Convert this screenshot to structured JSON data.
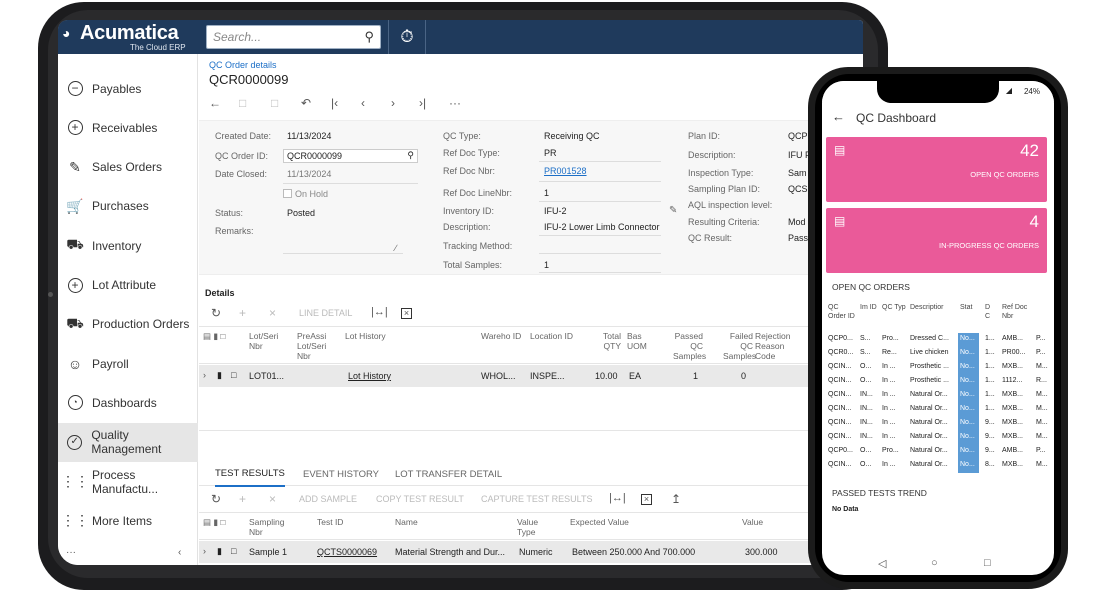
{
  "brand": {
    "name": "Acumatica",
    "tagline": "The Cloud ERP"
  },
  "search": {
    "placeholder": "Search..."
  },
  "sidebar": {
    "items": [
      {
        "label": "Payables",
        "icon": "minus-circle-icon"
      },
      {
        "label": "Receivables",
        "icon": "plus-circle-icon"
      },
      {
        "label": "Sales Orders",
        "icon": "edit-icon"
      },
      {
        "label": "Purchases",
        "icon": "cart-icon"
      },
      {
        "label": "Inventory",
        "icon": "truck-icon"
      },
      {
        "label": "Lot Attribute",
        "icon": "plus-circle-icon"
      },
      {
        "label": "Production Orders",
        "icon": "truck-icon"
      },
      {
        "label": "Payroll",
        "icon": "person-dollar-icon"
      },
      {
        "label": "Dashboards",
        "icon": "gauge-icon"
      },
      {
        "label": "Quality Management",
        "icon": "check-badge-icon"
      },
      {
        "label": "Process Manufactu...",
        "icon": "grid-icon"
      },
      {
        "label": "More Items",
        "icon": "grid-icon"
      }
    ],
    "active": "Quality Management"
  },
  "page": {
    "breadcrumb": "QC Order details",
    "title": "QCR0000099"
  },
  "form": {
    "created_date_label": "Created Date:",
    "created_date": "11/13/2024",
    "qc_order_id_label": "QC Order ID:",
    "qc_order_id": "QCR0000099",
    "date_closed_label": "Date Closed:",
    "date_closed": "11/13/2024",
    "on_hold_label": "On Hold",
    "status_label": "Status:",
    "status": "Posted",
    "remarks_label": "Remarks:",
    "qc_type_label": "QC Type:",
    "qc_type": "Receiving QC",
    "ref_doc_type_label": "Ref Doc Type:",
    "ref_doc_type": "PR",
    "ref_doc_nbr_label": "Ref Doc Nbr:",
    "ref_doc_nbr": "PR001528",
    "ref_doc_line_label": "Ref Doc LineNbr:",
    "ref_doc_line": "1",
    "inventory_id_label": "Inventory ID:",
    "inventory_id": "IFU-2",
    "description_label": "Description:",
    "description": "IFU-2 Lower Limb Connector",
    "tracking_label": "Tracking Method:",
    "total_samples_label": "Total Samples:",
    "total_samples": "1",
    "plan_id_label": "Plan ID:",
    "plan_id": "QCP",
    "desc2_label": "Description:",
    "desc2": "IFU F",
    "inspection_type_label": "Inspection Type:",
    "inspection_type": "Sam",
    "sampling_plan_label": "Sampling Plan ID:",
    "sampling_plan": "QCS",
    "aql_label": "AQL inspection level:",
    "resulting_label": "Resulting Criteria:",
    "resulting": "Mod",
    "qc_result_label": "QC Result:",
    "qc_result": "Pass"
  },
  "details": {
    "title": "Details",
    "toolbar": {
      "line_detail": "LINE DETAIL"
    },
    "columns": [
      "Lot/Seri Nbr",
      "PreAssi Lot/Seri Nbr",
      "Lot History",
      "Wareho ID",
      "Location ID",
      "Total QTY",
      "Bas UOM",
      "Passed QC Samples",
      "Failed QC Samples",
      "Rejection Reason Code"
    ],
    "row": {
      "lot": "LOT01...",
      "lot_history": "Lot History",
      "warehouse": "WHOL...",
      "location": "INSPE...",
      "total_qty": "10.00",
      "uom": "EA",
      "passed": "1",
      "failed": "0"
    }
  },
  "tabs": [
    "TEST RESULTS",
    "EVENT HISTORY",
    "LOT TRANSFER DETAIL"
  ],
  "tests": {
    "toolbar": {
      "add_sample": "ADD SAMPLE",
      "copy": "COPY TEST RESULT",
      "capture": "CAPTURE TEST RESULTS"
    },
    "columns": [
      "Sampling Nbr",
      "Test ID",
      "Name",
      "Value Type",
      "Expected Value",
      "Value"
    ],
    "row": {
      "sampling": "Sample 1",
      "test_id": "QCTS0000069",
      "name": "Material Strength and Dur...",
      "value_type": "Numeric",
      "expected": "Between 250.000 And 700.000",
      "value": "300.000"
    }
  },
  "phone": {
    "battery": "24%",
    "title": "QC Dashboard",
    "cards": [
      {
        "count": "42",
        "label": "OPEN QC ORDERS"
      },
      {
        "count": "4",
        "label": "IN-PROGRESS QC ORDERS"
      }
    ],
    "open_title": "OPEN QC ORDERS",
    "columns": [
      "QC Order ID",
      "Im ID",
      "QC Typ",
      "Descriptior",
      "Stat",
      "D C",
      "Ref Doc Nbr"
    ],
    "rows": [
      [
        "QCP0...",
        "S...",
        "Pro...",
        "Dressed C...",
        "No...",
        "1...",
        "AMB...",
        "P..."
      ],
      [
        "QCR0...",
        "S...",
        "Re...",
        "Live chicken",
        "No...",
        "1...",
        "PR00...",
        "P..."
      ],
      [
        "QCIN...",
        "O...",
        "In ...",
        "Prosthetic ...",
        "No...",
        "1...",
        "MXB...",
        "M..."
      ],
      [
        "QCIN...",
        "O...",
        "In ...",
        "Prosthetic ...",
        "No...",
        "1...",
        "1112...",
        "R..."
      ],
      [
        "QCIN...",
        "IN...",
        "In ...",
        "Natural Or...",
        "No...",
        "1...",
        "MXB...",
        "M..."
      ],
      [
        "QCIN...",
        "IN...",
        "In ...",
        "Natural Or...",
        "No...",
        "1...",
        "MXB...",
        "M..."
      ],
      [
        "QCIN...",
        "IN...",
        "In ...",
        "Natural Or...",
        "No...",
        "9...",
        "MXB...",
        "M..."
      ],
      [
        "QCIN...",
        "IN...",
        "In ...",
        "Natural Or...",
        "No...",
        "9...",
        "MXB...",
        "M..."
      ],
      [
        "QCP0...",
        "O...",
        "Pro...",
        "Natural Or...",
        "No...",
        "9...",
        "AMB...",
        "P..."
      ],
      [
        "QCIN...",
        "O...",
        "In ...",
        "Natural Or...",
        "No...",
        "8...",
        "MXB...",
        "M..."
      ]
    ],
    "trend_title": "PASSED TESTS TREND",
    "no_data": "No Data"
  },
  "colors": {
    "header": "#1f3a5c",
    "card": "#ea5a99",
    "status_cell": "#5b9bd5"
  }
}
